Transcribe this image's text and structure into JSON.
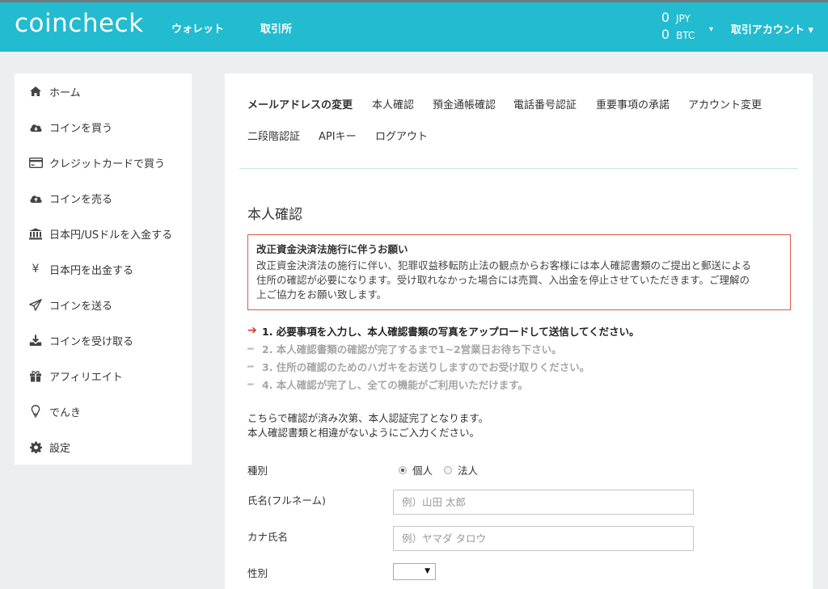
{
  "header": {
    "logo": "coincheck",
    "nav": [
      "ウォレット",
      "取引所"
    ],
    "balances": [
      {
        "amount": "0",
        "currency": "JPY"
      },
      {
        "amount": "0",
        "currency": "BTC"
      }
    ],
    "account_label": "取引アカウント",
    "caret": "▾"
  },
  "sidebar": {
    "items": [
      {
        "label": "ホーム",
        "icon": "home-icon",
        "glyph": "⌂"
      },
      {
        "label": "コインを買う",
        "icon": "cloud-download-icon",
        "glyph": "☁"
      },
      {
        "label": "クレジットカードで買う",
        "icon": "credit-card-icon",
        "glyph": "▭"
      },
      {
        "label": "コインを売る",
        "icon": "cloud-upload-icon",
        "glyph": "☁"
      },
      {
        "label": "日本円/USドルを入金する",
        "icon": "bank-icon",
        "glyph": "🏛"
      },
      {
        "label": "日本円を出金する",
        "icon": "yen-icon",
        "glyph": "¥"
      },
      {
        "label": "コインを送る",
        "icon": "send-icon",
        "glyph": "➤"
      },
      {
        "label": "コインを受け取る",
        "icon": "download-icon",
        "glyph": "⤓"
      },
      {
        "label": "アフィリエイト",
        "icon": "gift-icon",
        "glyph": "🎁"
      },
      {
        "label": "でんき",
        "icon": "lightbulb-icon",
        "glyph": "💡"
      },
      {
        "label": "設定",
        "icon": "gear-icon",
        "glyph": "⚙"
      }
    ]
  },
  "tabs": [
    "メールアドレスの変更",
    "本人確認",
    "預金通帳確認",
    "電話番号認証",
    "重要事項の承諾",
    "アカウント変更",
    "二段階認証",
    "APIキー",
    "ログアウト"
  ],
  "section_title": "本人確認",
  "notice": {
    "title": "改正資金決済法施行に伴うお願い",
    "lines": [
      "改正資金決済法の施行に伴い、犯罪収益移転防止法の観点からお客様には本人確認書類のご提出と郵送による",
      "住所の確認が必要になります。受け取れなかった場合には売買、入出金を停止させていただきます。ご理解の",
      "上ご協力をお願い致します。"
    ]
  },
  "steps": [
    {
      "mark": "➔",
      "text": "1. 必要事項を入力し、本人確認書類の写真をアップロードして送信してください。"
    },
    {
      "mark": "━",
      "text": "2. 本人確認書類の確認が完了するまで1~2営業日お待ち下さい。"
    },
    {
      "mark": "━",
      "text": "3. 住所の確認のためのハガキをお送りしますのでお受け取りください。"
    },
    {
      "mark": "━",
      "text": "4. 本人確認が完了し、全ての機能がご利用いただけます。"
    }
  ],
  "description": [
    "こちらで確認が済み次第、本人認証完了となります。",
    "本人確認書類と相違がないようにご入力ください。"
  ],
  "form": {
    "type_label": "種別",
    "type_options": [
      "個人",
      "法人"
    ],
    "name_label": "氏名(フルネーム)",
    "name_placeholder": "例）山田 太郎",
    "kana_label": "カナ氏名",
    "kana_placeholder": "例）ヤマダ タロウ",
    "gender_label": "性別",
    "gender_select_caret": "▼"
  }
}
